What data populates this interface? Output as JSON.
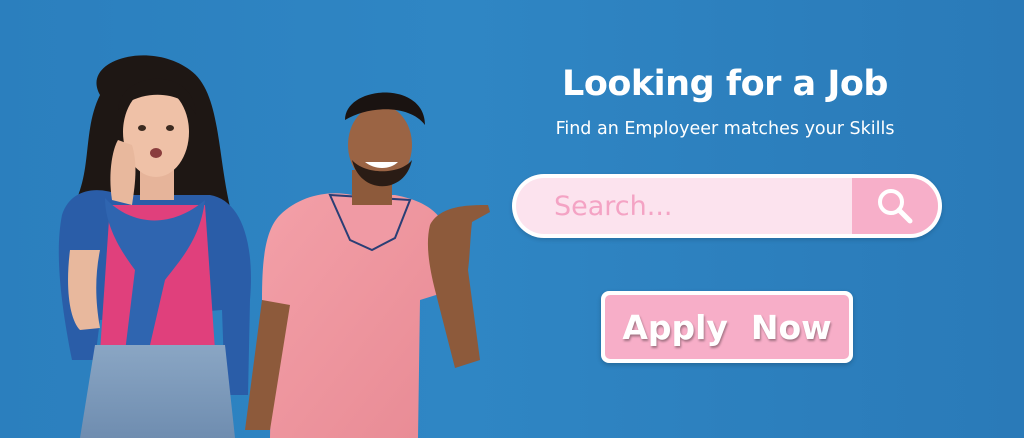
{
  "hero": {
    "title": "Looking for a Job",
    "subtitle": "Find an Employeer matches your Skills"
  },
  "search": {
    "placeholder": "Search...",
    "button_icon": "search-icon"
  },
  "cta": {
    "apply_label": "Apply  Now"
  },
  "colors": {
    "background": "#2d82c1",
    "search_fill": "#fce3ee",
    "search_placeholder": "#f4a3c4",
    "accent_pink": "#f7afc9",
    "text_white": "#ffffff"
  }
}
